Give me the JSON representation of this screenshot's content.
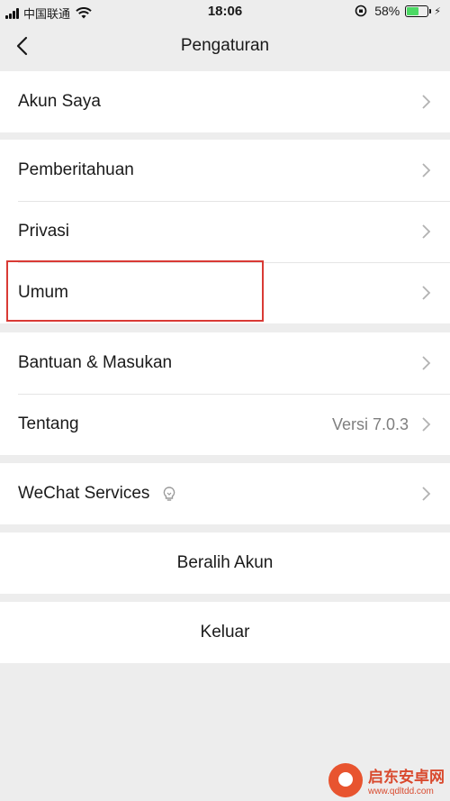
{
  "status_bar": {
    "carrier": "中国联通",
    "time": "18:06",
    "battery_percent": "58%",
    "battery_level": 0.58,
    "icons": [
      "signal-icon",
      "wifi-icon",
      "orientation-lock-icon",
      "battery-icon",
      "charging-icon"
    ]
  },
  "nav": {
    "title": "Pengaturan",
    "back_icon": "back-chevron-icon"
  },
  "sections": {
    "account": {
      "akun_saya": "Akun Saya"
    },
    "general": {
      "pemberitahuan": "Pemberitahuan",
      "privasi": "Privasi",
      "umum": "Umum"
    },
    "about": {
      "bantuan": "Bantuan & Masukan",
      "tentang": "Tentang",
      "tentang_value": "Versi 7.0.3"
    },
    "services": {
      "wechat_services": "WeChat Services",
      "services_icon": "lightbulb-icon"
    },
    "switch_account": "Beralih Akun",
    "logout": "Keluar"
  },
  "highlight": {
    "target": "Umum",
    "color": "#d93a35"
  },
  "watermark": {
    "title": "启东安卓网",
    "url": "www.qdltdd.com"
  },
  "colors": {
    "background": "#ededed",
    "row": "#ffffff",
    "chevron": "#b2b2b2",
    "value_text": "#7f7f7f"
  }
}
